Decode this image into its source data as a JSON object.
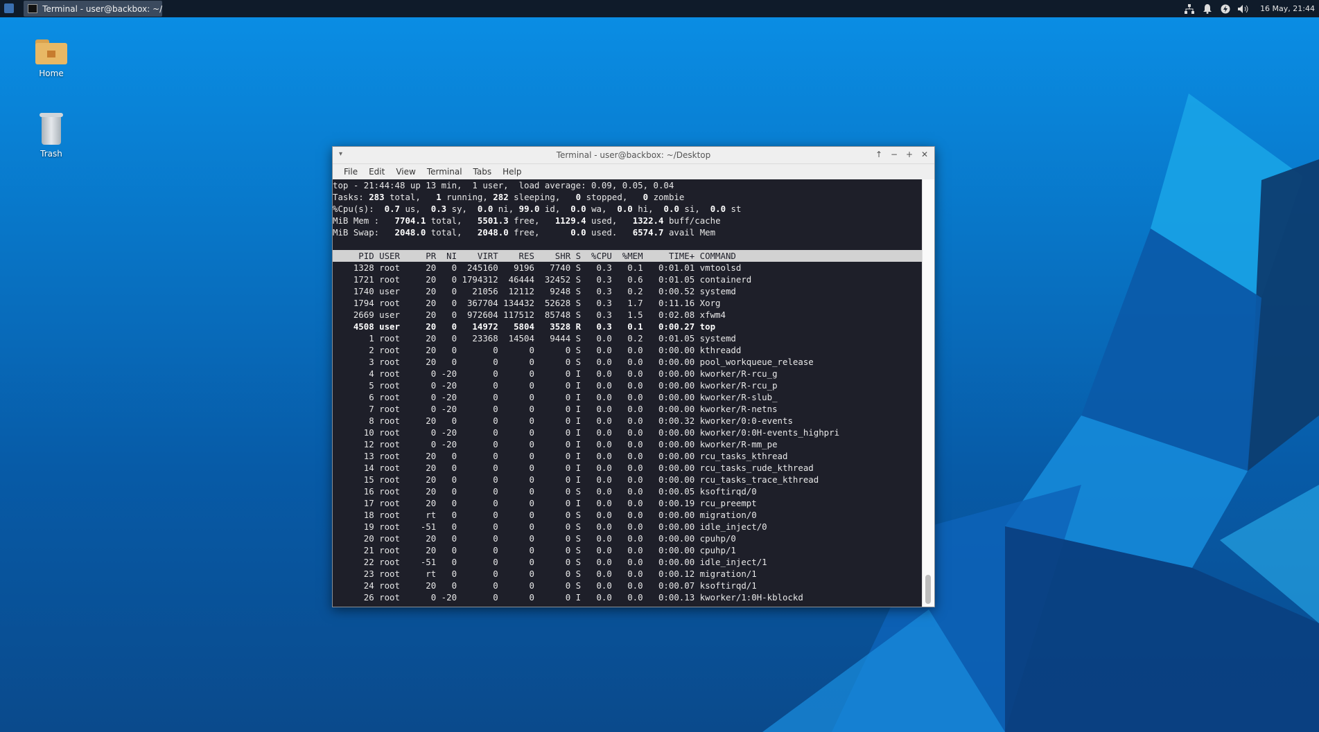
{
  "panel": {
    "task_title": "Terminal - user@backbox: ~/...",
    "clock": "16 May, 21:44",
    "icons": [
      "network-icon",
      "bell-icon",
      "power-icon",
      "volume-icon"
    ]
  },
  "desktop": {
    "home_label": "Home",
    "trash_label": "Trash"
  },
  "window": {
    "title": "Terminal - user@backbox: ~/Desktop",
    "menu": [
      "File",
      "Edit",
      "View",
      "Terminal",
      "Tabs",
      "Help"
    ]
  },
  "top": {
    "uptime_line": "top - 21:44:48 up 13 min,  1 user,  load average: 0.09, 0.05, 0.04",
    "tasks": {
      "total": "283",
      "running": "1",
      "sleeping": "282",
      "stopped": "0",
      "zombie": "0"
    },
    "cpu": {
      "us": "0.7",
      "sy": "0.3",
      "ni": "0.0",
      "id": "99.0",
      "wa": "0.0",
      "hi": "0.0",
      "si": "0.0",
      "st": "0.0"
    },
    "mem": {
      "total": "7704.1",
      "free": "5501.3",
      "used": "1129.4",
      "buff": "1322.4"
    },
    "swap": {
      "total": "2048.0",
      "free": "2048.0",
      "used": "0.0",
      "avail": "6574.7"
    },
    "columns": [
      "PID",
      "USER",
      "PR",
      "NI",
      "VIRT",
      "RES",
      "SHR",
      "S",
      "%CPU",
      "%MEM",
      "TIME+",
      "COMMAND"
    ],
    "rows": [
      [
        "1328",
        "root",
        "20",
        "0",
        "245160",
        "9196",
        "7740",
        "S",
        "0.3",
        "0.1",
        "0:01.01",
        "vmtoolsd"
      ],
      [
        "1721",
        "root",
        "20",
        "0",
        "1794312",
        "46444",
        "32452",
        "S",
        "0.3",
        "0.6",
        "0:01.05",
        "containerd"
      ],
      [
        "1740",
        "user",
        "20",
        "0",
        "21056",
        "12112",
        "9248",
        "S",
        "0.3",
        "0.2",
        "0:00.52",
        "systemd"
      ],
      [
        "1794",
        "root",
        "20",
        "0",
        "367704",
        "134432",
        "52628",
        "S",
        "0.3",
        "1.7",
        "0:11.16",
        "Xorg"
      ],
      [
        "2669",
        "user",
        "20",
        "0",
        "972604",
        "117512",
        "85748",
        "S",
        "0.3",
        "1.5",
        "0:02.08",
        "xfwm4"
      ],
      [
        "4508",
        "user",
        "20",
        "0",
        "14972",
        "5804",
        "3528",
        "R",
        "0.3",
        "0.1",
        "0:00.27",
        "top"
      ],
      [
        "1",
        "root",
        "20",
        "0",
        "23368",
        "14504",
        "9444",
        "S",
        "0.0",
        "0.2",
        "0:01.05",
        "systemd"
      ],
      [
        "2",
        "root",
        "20",
        "0",
        "0",
        "0",
        "0",
        "S",
        "0.0",
        "0.0",
        "0:00.00",
        "kthreadd"
      ],
      [
        "3",
        "root",
        "20",
        "0",
        "0",
        "0",
        "0",
        "S",
        "0.0",
        "0.0",
        "0:00.00",
        "pool_workqueue_release"
      ],
      [
        "4",
        "root",
        "0",
        "-20",
        "0",
        "0",
        "0",
        "I",
        "0.0",
        "0.0",
        "0:00.00",
        "kworker/R-rcu_g"
      ],
      [
        "5",
        "root",
        "0",
        "-20",
        "0",
        "0",
        "0",
        "I",
        "0.0",
        "0.0",
        "0:00.00",
        "kworker/R-rcu_p"
      ],
      [
        "6",
        "root",
        "0",
        "-20",
        "0",
        "0",
        "0",
        "I",
        "0.0",
        "0.0",
        "0:00.00",
        "kworker/R-slub_"
      ],
      [
        "7",
        "root",
        "0",
        "-20",
        "0",
        "0",
        "0",
        "I",
        "0.0",
        "0.0",
        "0:00.00",
        "kworker/R-netns"
      ],
      [
        "8",
        "root",
        "20",
        "0",
        "0",
        "0",
        "0",
        "I",
        "0.0",
        "0.0",
        "0:00.32",
        "kworker/0:0-events"
      ],
      [
        "10",
        "root",
        "0",
        "-20",
        "0",
        "0",
        "0",
        "I",
        "0.0",
        "0.0",
        "0:00.00",
        "kworker/0:0H-events_highpri"
      ],
      [
        "12",
        "root",
        "0",
        "-20",
        "0",
        "0",
        "0",
        "I",
        "0.0",
        "0.0",
        "0:00.00",
        "kworker/R-mm_pe"
      ],
      [
        "13",
        "root",
        "20",
        "0",
        "0",
        "0",
        "0",
        "I",
        "0.0",
        "0.0",
        "0:00.00",
        "rcu_tasks_kthread"
      ],
      [
        "14",
        "root",
        "20",
        "0",
        "0",
        "0",
        "0",
        "I",
        "0.0",
        "0.0",
        "0:00.00",
        "rcu_tasks_rude_kthread"
      ],
      [
        "15",
        "root",
        "20",
        "0",
        "0",
        "0",
        "0",
        "I",
        "0.0",
        "0.0",
        "0:00.00",
        "rcu_tasks_trace_kthread"
      ],
      [
        "16",
        "root",
        "20",
        "0",
        "0",
        "0",
        "0",
        "S",
        "0.0",
        "0.0",
        "0:00.05",
        "ksoftirqd/0"
      ],
      [
        "17",
        "root",
        "20",
        "0",
        "0",
        "0",
        "0",
        "I",
        "0.0",
        "0.0",
        "0:00.19",
        "rcu_preempt"
      ],
      [
        "18",
        "root",
        "rt",
        "0",
        "0",
        "0",
        "0",
        "S",
        "0.0",
        "0.0",
        "0:00.00",
        "migration/0"
      ],
      [
        "19",
        "root",
        "-51",
        "0",
        "0",
        "0",
        "0",
        "S",
        "0.0",
        "0.0",
        "0:00.00",
        "idle_inject/0"
      ],
      [
        "20",
        "root",
        "20",
        "0",
        "0",
        "0",
        "0",
        "S",
        "0.0",
        "0.0",
        "0:00.00",
        "cpuhp/0"
      ],
      [
        "21",
        "root",
        "20",
        "0",
        "0",
        "0",
        "0",
        "S",
        "0.0",
        "0.0",
        "0:00.00",
        "cpuhp/1"
      ],
      [
        "22",
        "root",
        "-51",
        "0",
        "0",
        "0",
        "0",
        "S",
        "0.0",
        "0.0",
        "0:00.00",
        "idle_inject/1"
      ],
      [
        "23",
        "root",
        "rt",
        "0",
        "0",
        "0",
        "0",
        "S",
        "0.0",
        "0.0",
        "0:00.12",
        "migration/1"
      ],
      [
        "24",
        "root",
        "20",
        "0",
        "0",
        "0",
        "0",
        "S",
        "0.0",
        "0.0",
        "0:00.07",
        "ksoftirqd/1"
      ],
      [
        "26",
        "root",
        "0",
        "-20",
        "0",
        "0",
        "0",
        "I",
        "0.0",
        "0.0",
        "0:00.13",
        "kworker/1:0H-kblockd"
      ]
    ]
  }
}
